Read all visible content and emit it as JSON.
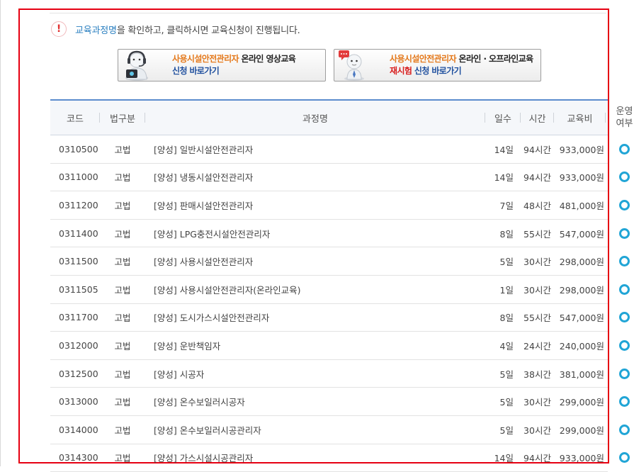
{
  "notice": {
    "link_text": "교육과정명",
    "text": "을 확인하고, 클릭하시면 교육신청이 진행됩니다.",
    "icon": "exclamation-icon"
  },
  "banners": [
    {
      "line1_highlight": "사용시설안전관리자",
      "line1_rest": " 온라인 영상교육",
      "line2_prefix": "",
      "line2": "신청 바로가기",
      "icon": "headset-person-icon"
    },
    {
      "line1_highlight": "사용시설안전관리자",
      "line1_rest": " 온라인 · 오프라인교육",
      "line2_prefix": "재시험",
      "line2": " 신청 바로가기",
      "icon": "speech-person-icon"
    }
  ],
  "table": {
    "headers": {
      "code": "코드",
      "law": "법구분",
      "name": "과정명",
      "days": "일수",
      "hours": "시간",
      "fee": "교육비",
      "operating_1": "운영",
      "operating_2": "여부"
    },
    "rows": [
      {
        "code": "0310500",
        "law": "고법",
        "name": "[양성] 일반시설안전관리자",
        "days": "14일",
        "hours": "94시간",
        "fee": "933,000원",
        "operating": "o"
      },
      {
        "code": "0311000",
        "law": "고법",
        "name": "[양성] 냉동시설안전관리자",
        "days": "14일",
        "hours": "94시간",
        "fee": "933,000원",
        "operating": "o"
      },
      {
        "code": "0311200",
        "law": "고법",
        "name": "[양성] 판매시설안전관리자",
        "days": "7일",
        "hours": "48시간",
        "fee": "481,000원",
        "operating": "o"
      },
      {
        "code": "0311400",
        "law": "고법",
        "name": "[양성] LPG충전시설안전관리자",
        "days": "8일",
        "hours": "55시간",
        "fee": "547,000원",
        "operating": "o"
      },
      {
        "code": "0311500",
        "law": "고법",
        "name": "[양성] 사용시설안전관리자",
        "days": "5일",
        "hours": "30시간",
        "fee": "298,000원",
        "operating": "o"
      },
      {
        "code": "0311505",
        "law": "고법",
        "name": "[양성] 사용시설안전관리자(온라인교육)",
        "days": "1일",
        "hours": "30시간",
        "fee": "298,000원",
        "operating": "o"
      },
      {
        "code": "0311700",
        "law": "고법",
        "name": "[양성] 도시가스시설안전관리자",
        "days": "8일",
        "hours": "55시간",
        "fee": "547,000원",
        "operating": "o"
      },
      {
        "code": "0312000",
        "law": "고법",
        "name": "[양성] 운반책임자",
        "days": "4일",
        "hours": "24시간",
        "fee": "240,000원",
        "operating": "o"
      },
      {
        "code": "0312500",
        "law": "고법",
        "name": "[양성] 시공자",
        "days": "5일",
        "hours": "38시간",
        "fee": "381,000원",
        "operating": "o"
      },
      {
        "code": "0313000",
        "law": "고법",
        "name": "[양성] 온수보일러시공자",
        "days": "5일",
        "hours": "30시간",
        "fee": "299,000원",
        "operating": "o"
      },
      {
        "code": "0314000",
        "law": "고법",
        "name": "[양성] 온수보일러시공관리자",
        "days": "5일",
        "hours": "30시간",
        "fee": "299,000원",
        "operating": "o"
      },
      {
        "code": "0314300",
        "law": "고법",
        "name": "[양성] 가스시설시공관리자",
        "days": "14일",
        "hours": "94시간",
        "fee": "933,000원",
        "operating": "o"
      }
    ]
  },
  "colors": {
    "highlight_border": "#e60012",
    "header_top_border": "#5b8ccd",
    "operating_ring": "#21a5d6",
    "banner_orange": "#e4791c",
    "banner_blue": "#1f4f9e",
    "banner_red": "#d81e1e"
  }
}
